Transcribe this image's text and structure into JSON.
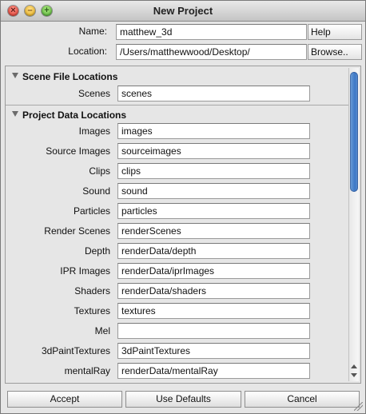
{
  "window": {
    "title": "New Project"
  },
  "top": {
    "name_label": "Name:",
    "name_value": "matthew_3d",
    "location_label": "Location:",
    "location_value": "/Users/matthewwood/Desktop/",
    "help_label": "Help",
    "browse_label": "Browse.."
  },
  "scene_section": {
    "title": "Scene File Locations",
    "rows": [
      {
        "label": "Scenes",
        "value": "scenes"
      }
    ]
  },
  "data_section": {
    "title": "Project Data Locations",
    "rows": [
      {
        "label": "Images",
        "value": "images"
      },
      {
        "label": "Source Images",
        "value": "sourceimages"
      },
      {
        "label": "Clips",
        "value": "clips"
      },
      {
        "label": "Sound",
        "value": "sound"
      },
      {
        "label": "Particles",
        "value": "particles"
      },
      {
        "label": "Render Scenes",
        "value": "renderScenes"
      },
      {
        "label": "Depth",
        "value": "renderData/depth"
      },
      {
        "label": "IPR Images",
        "value": "renderData/iprImages"
      },
      {
        "label": "Shaders",
        "value": "renderData/shaders"
      },
      {
        "label": "Textures",
        "value": "textures"
      },
      {
        "label": "Mel",
        "value": ""
      },
      {
        "label": "3dPaintTextures",
        "value": "3dPaintTextures"
      },
      {
        "label": "mentalRay",
        "value": "renderData/mentalRay"
      }
    ]
  },
  "buttons": {
    "accept": "Accept",
    "use_defaults": "Use Defaults",
    "cancel": "Cancel"
  }
}
